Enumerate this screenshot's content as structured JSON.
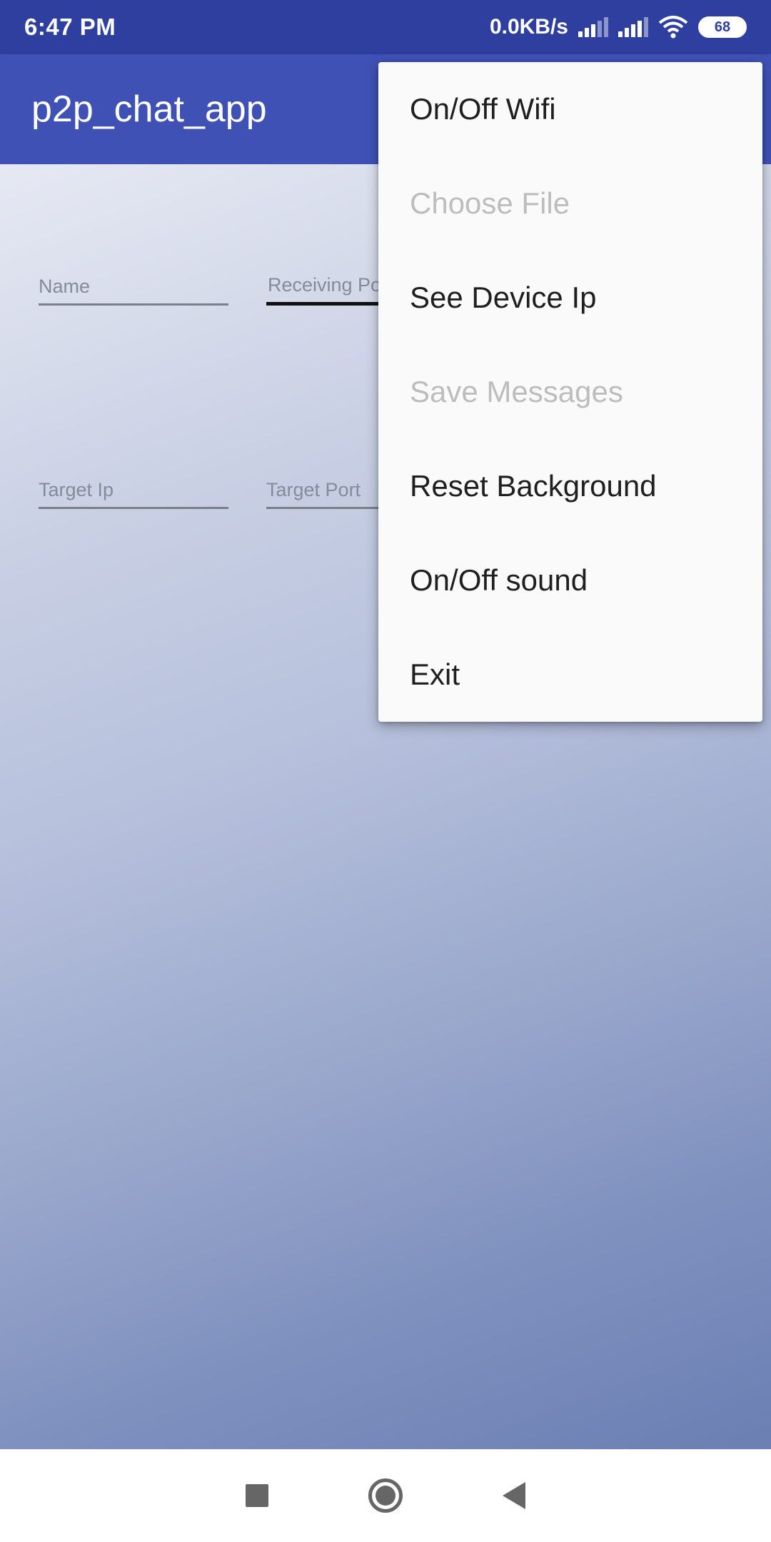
{
  "status_bar": {
    "time": "6:47 PM",
    "network_speed": "0.0KB/s",
    "battery": "68",
    "icons": [
      "signal-icon",
      "signal-icon",
      "wifi-icon",
      "battery-icon"
    ]
  },
  "app_bar": {
    "title": "p2p_chat_app"
  },
  "form": {
    "name_placeholder": "Name",
    "receiving_port_placeholder": "Receiving Port",
    "target_ip_placeholder": "Target Ip",
    "target_port_placeholder": "Target Port"
  },
  "overflow_menu": {
    "items": [
      {
        "label": "On/Off Wifi",
        "enabled": true
      },
      {
        "label": "Choose File",
        "enabled": false
      },
      {
        "label": "See Device Ip",
        "enabled": true
      },
      {
        "label": "Save Messages",
        "enabled": false
      },
      {
        "label": "Reset Background",
        "enabled": true
      },
      {
        "label": "On/Off sound",
        "enabled": true
      },
      {
        "label": "Exit",
        "enabled": true
      }
    ]
  },
  "nav_bar": {
    "icons": [
      "recents-icon",
      "home-icon",
      "back-icon"
    ]
  },
  "colors": {
    "status_bar": "#2f3f9f",
    "app_bar": "#3f51b5",
    "menu_background": "#fafafa",
    "disabled_text": "#bdbdbd"
  }
}
